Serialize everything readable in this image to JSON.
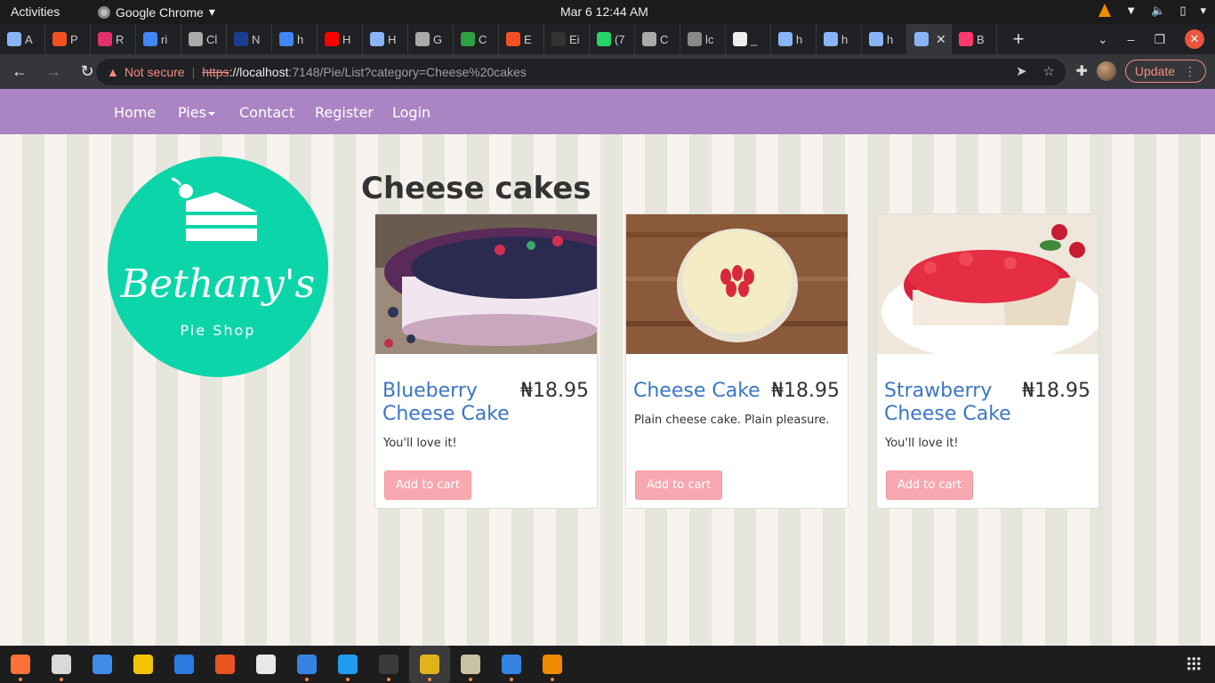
{
  "system": {
    "activities": "Activities",
    "app_name": "Google Chrome",
    "clock": "Mar 6  12:44 AM"
  },
  "tabs": [
    {
      "label": "A",
      "color": "#8ab4f8"
    },
    {
      "label": "P",
      "color": "#f25022"
    },
    {
      "label": "R",
      "color": "#e1306c"
    },
    {
      "label": "ri",
      "color": "#4285f4"
    },
    {
      "label": "Cl",
      "color": "#aaaaaa"
    },
    {
      "label": "N",
      "color": "#1a3d8f"
    },
    {
      "label": "h",
      "color": "#4285f4"
    },
    {
      "label": "H",
      "color": "#ff0000"
    },
    {
      "label": "H",
      "color": "#8ab4f8"
    },
    {
      "label": "G",
      "color": "#aaaaaa"
    },
    {
      "label": "C",
      "color": "#2ea043"
    },
    {
      "label": "E",
      "color": "#f25022"
    },
    {
      "label": "Ei",
      "color": "#333333"
    },
    {
      "label": "(7",
      "color": "#25d366"
    },
    {
      "label": "C",
      "color": "#aaaaaa"
    },
    {
      "label": "lc",
      "color": "#888888"
    },
    {
      "label": "_",
      "color": "#eeeeee"
    },
    {
      "label": "h",
      "color": "#8ab4f8"
    },
    {
      "label": "h",
      "color": "#8ab4f8"
    },
    {
      "label": "h",
      "color": "#8ab4f8"
    },
    {
      "label": "",
      "color": "#8ab4f8",
      "active": true
    },
    {
      "label": "B",
      "color": "#ff3b6b"
    }
  ],
  "browser": {
    "not_secure": "Not secure",
    "url_scheme": "https",
    "url_host": "://localhost",
    "url_rest": ":7148/Pie/List?category=Cheese%20cakes",
    "update_label": "Update"
  },
  "site": {
    "nav": {
      "home": "Home",
      "pies": "Pies",
      "contact": "Contact",
      "register": "Register",
      "login": "Login"
    },
    "logo_script": "Bethany's",
    "logo_sub": "Pie Shop",
    "category_title": "Cheese cakes",
    "accent_color": "#ab84c3",
    "logo_color": "#0cd5a9"
  },
  "products": [
    {
      "name": "Blueberry Cheese Cake",
      "price": "₦18.95",
      "description": "You'll love it!",
      "add_label": "Add to cart"
    },
    {
      "name": "Cheese Cake",
      "price": "₦18.95",
      "description": "Plain cheese cake. Plain pleasure.",
      "add_label": "Add to cart"
    },
    {
      "name": "Strawberry Cheese Cake",
      "price": "₦18.95",
      "description": "You'll love it!",
      "add_label": "Add to cart"
    }
  ],
  "dock": [
    {
      "name": "firefox-icon",
      "color": "#ff7139",
      "dot": true
    },
    {
      "name": "files-icon",
      "color": "#d9d9d9",
      "dot": true
    },
    {
      "name": "thunderbird-icon",
      "color": "#3f8be8",
      "dot": false
    },
    {
      "name": "rhythmbox-icon",
      "color": "#f5c400",
      "dot": false
    },
    {
      "name": "writer-icon",
      "color": "#2d7be0",
      "dot": false
    },
    {
      "name": "software-icon",
      "color": "#e95420",
      "dot": false
    },
    {
      "name": "document-viewer-icon",
      "color": "#e8e8e8",
      "dot": false
    },
    {
      "name": "help-icon",
      "color": "#3584e4",
      "dot": true
    },
    {
      "name": "vscode-icon",
      "color": "#1f9cf0",
      "dot": true
    },
    {
      "name": "terminal-icon",
      "color": "#3a3a3a",
      "dot": true
    },
    {
      "name": "chrome-icon",
      "color": "#e0b21b",
      "dot": true,
      "active": true
    },
    {
      "name": "archive-icon",
      "color": "#c8c1a6",
      "dot": true
    },
    {
      "name": "text-editor-icon",
      "color": "#3584e4",
      "dot": true
    },
    {
      "name": "vlc-icon",
      "color": "#f08a00",
      "dot": true
    }
  ]
}
